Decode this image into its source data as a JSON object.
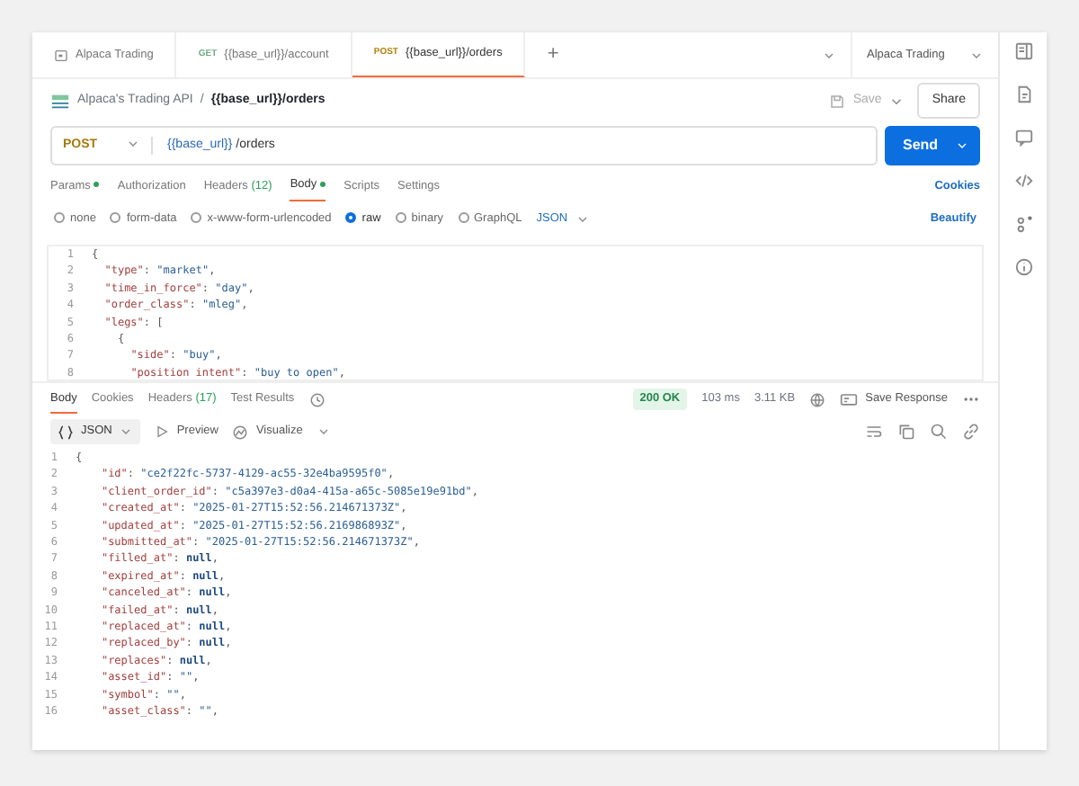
{
  "tabs": [
    {
      "kind": "workspace",
      "label": "Alpaca Trading",
      "selected": false
    },
    {
      "kind": "request",
      "method": "GET",
      "label": "{{base_url}}/account",
      "selected": false
    },
    {
      "kind": "request",
      "method": "POST",
      "label": "{{base_url}}/orders",
      "selected": true
    }
  ],
  "tab_add": "+",
  "environment": "Alpaca Trading",
  "breadcrumb": {
    "collection": "Alpaca's Trading API",
    "separator": "/",
    "request": "{{base_url}}/orders"
  },
  "save_label": "Save",
  "share_label": "Share",
  "method": "POST",
  "url": {
    "variable": "{{base_url}}",
    "path": " /orders"
  },
  "send_label": "Send",
  "request_tabs": [
    {
      "label": "Params",
      "dot": true,
      "selected": false
    },
    {
      "label": "Authorization",
      "dot": false,
      "selected": false
    },
    {
      "label": "Headers",
      "count": "(12)",
      "dot": false,
      "selected": false
    },
    {
      "label": "Body",
      "dot": true,
      "selected": true
    },
    {
      "label": "Scripts",
      "dot": false,
      "selected": false
    },
    {
      "label": "Settings",
      "dot": false,
      "selected": false
    }
  ],
  "cookies_label": "Cookies",
  "body_types": [
    {
      "label": "none",
      "selected": false
    },
    {
      "label": "form-data",
      "selected": false
    },
    {
      "label": "x-www-form-urlencoded",
      "selected": false
    },
    {
      "label": "raw",
      "selected": true
    },
    {
      "label": "binary",
      "selected": false
    },
    {
      "label": "GraphQL",
      "selected": false
    }
  ],
  "body_format": "JSON",
  "beautify_label": "Beautify",
  "request_body": [
    {
      "n": "1",
      "code": "{"
    },
    {
      "n": "2",
      "code": "  \"type\": \"market\","
    },
    {
      "n": "3",
      "code": "  \"time_in_force\": \"day\","
    },
    {
      "n": "4",
      "code": "  \"order_class\": \"mleg\","
    },
    {
      "n": "5",
      "code": "  \"legs\": ["
    },
    {
      "n": "6",
      "code": "    {"
    },
    {
      "n": "7",
      "code": "      \"side\": \"buy\","
    },
    {
      "n": "8",
      "code": "      \"position intent\": \"buy to open\","
    }
  ],
  "response_tabs": [
    {
      "label": "Body",
      "selected": true
    },
    {
      "label": "Cookies",
      "selected": false
    },
    {
      "label": "Headers",
      "count": "(17)",
      "selected": false
    },
    {
      "label": "Test Results",
      "selected": false
    }
  ],
  "status": "200 OK",
  "time": "103 ms",
  "size": "3.11 KB",
  "save_response_label": "Save Response",
  "response_format": "JSON",
  "preview_label": "Preview",
  "visualize_label": "Visualize",
  "response_body": [
    {
      "n": "1",
      "code": "{"
    },
    {
      "n": "2",
      "code": "    \"id\": \"ce2f22fc-5737-4129-ac55-32e4ba9595f0\","
    },
    {
      "n": "3",
      "code": "    \"client_order_id\": \"c5a397e3-d0a4-415a-a65c-5085e19e91bd\","
    },
    {
      "n": "4",
      "code": "    \"created_at\": \"2025-01-27T15:52:56.214671373Z\","
    },
    {
      "n": "5",
      "code": "    \"updated_at\": \"2025-01-27T15:52:56.216986893Z\","
    },
    {
      "n": "6",
      "code": "    \"submitted_at\": \"2025-01-27T15:52:56.214671373Z\","
    },
    {
      "n": "7",
      "code": "    \"filled_at\": null,"
    },
    {
      "n": "8",
      "code": "    \"expired_at\": null,"
    },
    {
      "n": "9",
      "code": "    \"canceled_at\": null,"
    },
    {
      "n": "10",
      "code": "    \"failed_at\": null,"
    },
    {
      "n": "11",
      "code": "    \"replaced_at\": null,"
    },
    {
      "n": "12",
      "code": "    \"replaced_by\": null,"
    },
    {
      "n": "13",
      "code": "    \"replaces\": null,"
    },
    {
      "n": "14",
      "code": "    \"asset_id\": \"\","
    },
    {
      "n": "15",
      "code": "    \"symbol\": \"\","
    },
    {
      "n": "16",
      "code": "    \"asset_class\": \"\","
    }
  ]
}
